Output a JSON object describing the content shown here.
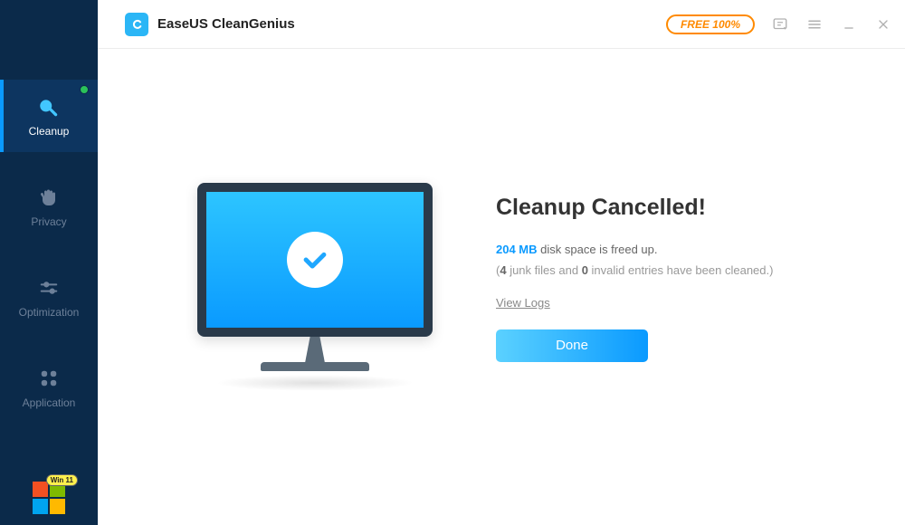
{
  "app": {
    "title": "EaseUS CleanGenius",
    "free_badge": "FREE 100%"
  },
  "sidebar": {
    "items": [
      {
        "label": "Cleanup"
      },
      {
        "label": "Privacy"
      },
      {
        "label": "Optimization"
      },
      {
        "label": "Application"
      }
    ],
    "win_badge": "Win 11"
  },
  "result": {
    "headline": "Cleanup Cancelled!",
    "freed_amount": "204 MB",
    "freed_suffix": " disk space is freed up.",
    "detail_prefix": "(",
    "junk_count": "4",
    "detail_mid1": " junk files and ",
    "invalid_count": "0",
    "detail_mid2": " invalid entries have been cleaned.)",
    "view_logs": "View Logs",
    "done": "Done"
  }
}
